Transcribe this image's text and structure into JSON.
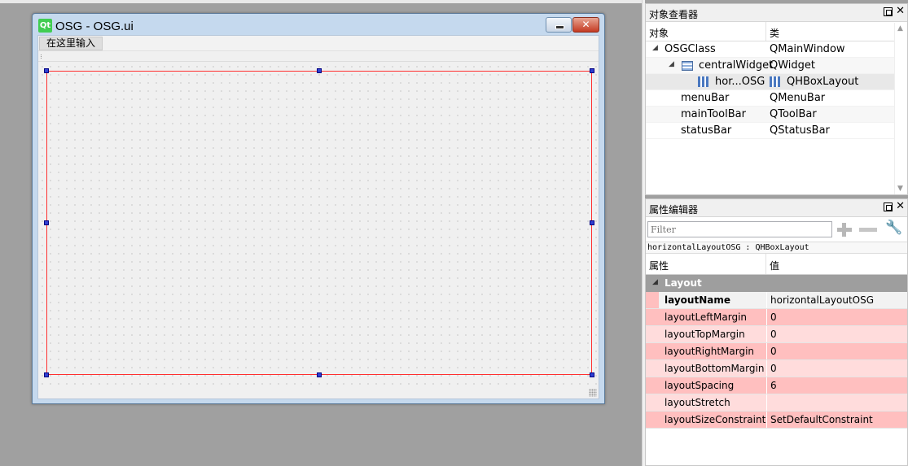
{
  "form": {
    "title": "OSG - OSG.ui",
    "logo_text": "Qt",
    "menu_placeholder": "在这里输入",
    "close_glyph": "✕"
  },
  "object_inspector": {
    "title": "对象查看器",
    "columns": [
      "对象",
      "类"
    ],
    "rows": [
      {
        "name": "OSGClass",
        "class": "QMainWindow",
        "expanded": true,
        "icon": "none"
      },
      {
        "name": "centralWidget",
        "class": "QWidget",
        "expanded": true,
        "icon": "widget-icon"
      },
      {
        "name": "hor...OSG",
        "class": "QHBoxLayout",
        "icon": "hbox-layout-icon"
      },
      {
        "name": "menuBar",
        "class": "QMenuBar"
      },
      {
        "name": "mainToolBar",
        "class": "QToolBar"
      },
      {
        "name": "statusBar",
        "class": "QStatusBar"
      }
    ]
  },
  "property_editor": {
    "title": "属性编辑器",
    "filter_placeholder": "Filter",
    "object_line": "horizontalLayoutOSG : QHBoxLayout",
    "columns": [
      "属性",
      "值"
    ],
    "group": "Layout",
    "properties": [
      {
        "name": "layoutName",
        "value": "horizontalLayoutOSG"
      },
      {
        "name": "layoutLeftMargin",
        "value": "0"
      },
      {
        "name": "layoutTopMargin",
        "value": "0"
      },
      {
        "name": "layoutRightMargin",
        "value": "0"
      },
      {
        "name": "layoutBottomMargin",
        "value": "0"
      },
      {
        "name": "layoutSpacing",
        "value": "6"
      },
      {
        "name": "layoutStretch",
        "value": ""
      },
      {
        "name": "layoutSizeConstraint",
        "value": "SetDefaultConstraint"
      }
    ]
  },
  "colors": {
    "accent_layout_border": "#ff3030",
    "handle": "#3040d0",
    "changed_property_bg": "#ffbfbf",
    "group_bg": "#9e9e9e"
  }
}
